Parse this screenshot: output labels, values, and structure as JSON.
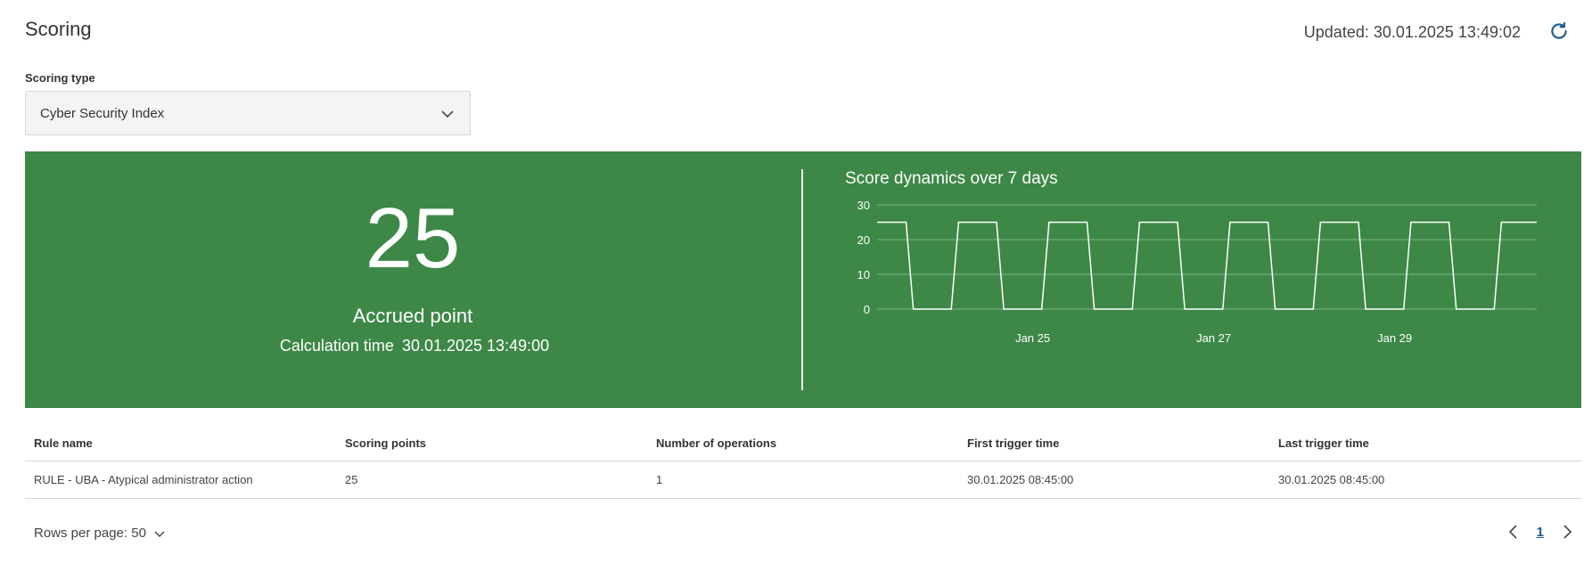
{
  "header": {
    "title": "Scoring",
    "updated": "Updated: 30.01.2025 13:49:02"
  },
  "filter": {
    "label": "Scoring type",
    "selected": "Cyber Security Index"
  },
  "summary": {
    "score": "25",
    "score_label": "Accrued point",
    "calc_label": "Calculation time",
    "calc_time": "30.01.2025 13:49:00"
  },
  "chart_title": "Score dynamics over 7 days",
  "chart_data": {
    "type": "line",
    "title": "Score dynamics over 7 days",
    "xlabel": "",
    "ylabel": "",
    "ylim": [
      0,
      30
    ],
    "yticks": [
      0,
      10,
      20,
      30
    ],
    "xtick_labels": [
      {
        "label": "Jan 25",
        "x": 25
      },
      {
        "label": "Jan 27",
        "x": 27
      },
      {
        "label": "Jan 29",
        "x": 29
      }
    ],
    "xlim": [
      23.28,
      30.57
    ],
    "grid": true,
    "series": [
      {
        "values_x": [
          23.28,
          23.6,
          23.68,
          24.1,
          24.18,
          24.6,
          24.68,
          25.1,
          25.18,
          25.6,
          25.68,
          26.1,
          26.18,
          26.6,
          26.68,
          27.1,
          27.18,
          27.6,
          27.68,
          28.1,
          28.18,
          28.6,
          28.68,
          29.1,
          29.18,
          29.6,
          29.68,
          30.1,
          30.18,
          30.57
        ],
        "values_y": [
          25,
          25,
          0,
          0,
          25,
          25,
          0,
          0,
          25,
          25,
          0,
          0,
          25,
          25,
          0,
          0,
          25,
          25,
          0,
          0,
          25,
          25,
          0,
          0,
          25,
          25,
          0,
          0,
          25,
          25
        ]
      }
    ],
    "colors": {
      "line": "#ffffff",
      "grid": "#7fb388",
      "text": "#ffffff"
    }
  },
  "table": {
    "columns": [
      "Rule name",
      "Scoring points",
      "Number of operations",
      "First trigger time",
      "Last trigger time"
    ],
    "rows": [
      [
        "RULE - UBA - Atypical administrator action",
        "25",
        "1",
        "30.01.2025 08:45:00",
        "30.01.2025 08:45:00"
      ]
    ]
  },
  "pagination": {
    "rows_per_page": "Rows per page: 50",
    "current_page": "1"
  },
  "icons": {
    "refresh": "refresh-icon",
    "dropdown": "chevron-down-icon",
    "prev": "chevron-left-icon",
    "next": "chevron-right-icon"
  },
  "colors": {
    "banner": "#3d8847",
    "page_link": "#1f5c8c"
  }
}
